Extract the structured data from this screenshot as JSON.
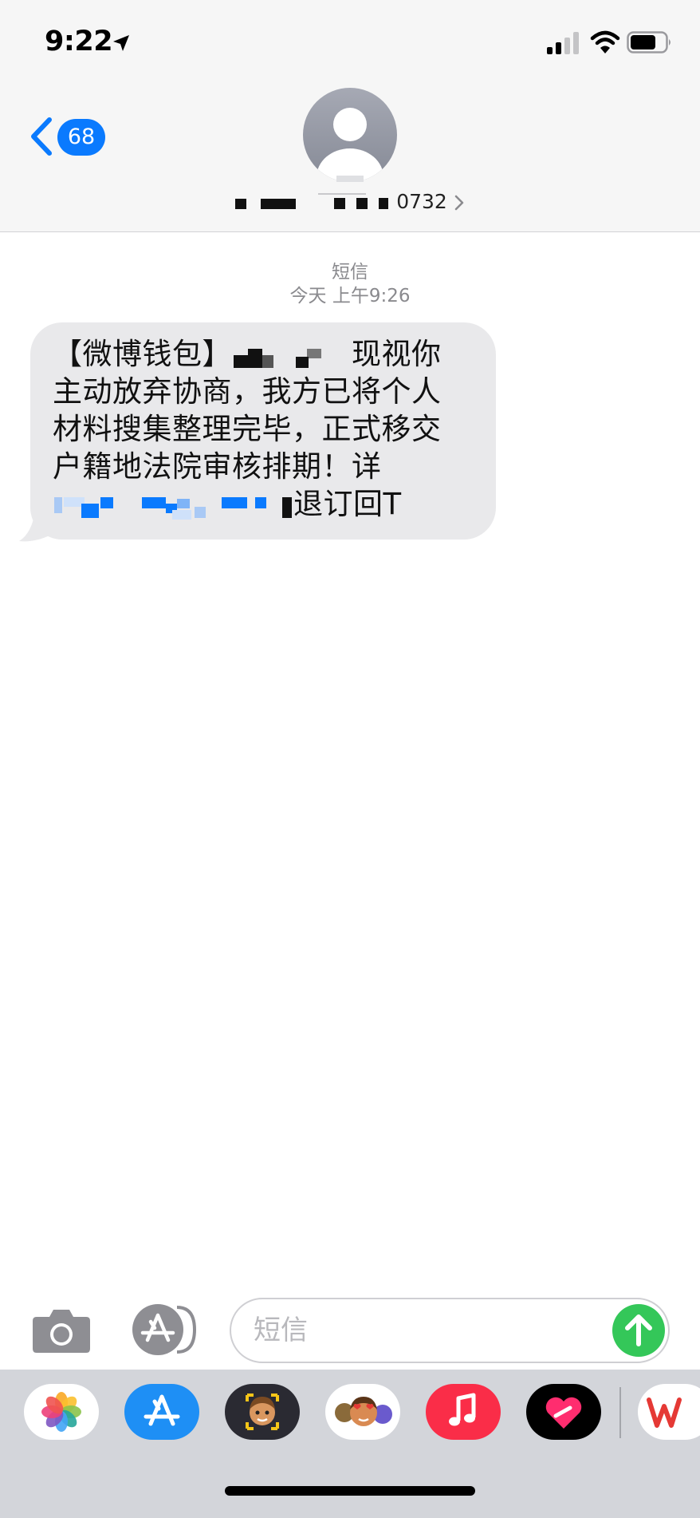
{
  "status_bar": {
    "time": "9:22",
    "icons": [
      "location-arrow-icon",
      "cellular-signal-icon",
      "wifi-icon",
      "battery-icon"
    ]
  },
  "header": {
    "back_badge": "68",
    "contact_number_suffix": "0732",
    "avatar_icon": "person-silhouette-icon"
  },
  "conversation": {
    "service_label": "短信",
    "timestamp": "今天 上午9:26",
    "message_lines": [
      {
        "start": "【微博钱包】",
        "end": "现视你"
      },
      {
        "start": "主动放弃协商，我方已将个人",
        "end": ""
      },
      {
        "start": "材料搜集整理完毕，正式移交",
        "end": ""
      },
      {
        "start": "户籍地法院审核排期！详",
        "end": ""
      },
      {
        "start": "",
        "end": "退订回T"
      }
    ]
  },
  "composer": {
    "placeholder": "短信",
    "send_icon": "arrow-up-icon"
  },
  "app_drawer": {
    "apps": [
      "photos-app-icon",
      "app-store-icon",
      "memoji-app-icon",
      "animoji-stickers-icon",
      "music-app-icon",
      "digital-touch-icon",
      "wps-office-icon"
    ]
  },
  "colors": {
    "accent": "#0a7afe",
    "send_green": "#34c759",
    "bubble_gray": "#e9e9eb",
    "music_red": "#fa2d48"
  }
}
